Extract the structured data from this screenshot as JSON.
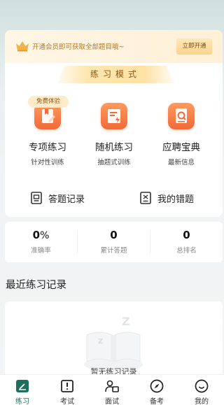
{
  "vip": {
    "text": "开通会员即可获取全部题目哦~",
    "button": "立即开通"
  },
  "mode_banner": "练习模式",
  "free_tag": "免费体验",
  "features": [
    {
      "title": "专项练习",
      "subtitle": "针对性训练",
      "icon": "bookmark-book-icon"
    },
    {
      "title": "随机练习",
      "subtitle": "抽题式训练",
      "icon": "random-doc-icon"
    },
    {
      "title": "应聘宝典",
      "subtitle": "最新信息",
      "icon": "search-book-icon"
    }
  ],
  "links": {
    "answer_record": "答题记录",
    "my_mistakes": "我的错题"
  },
  "stats": {
    "accuracy_value": "0",
    "accuracy_unit": "%",
    "accuracy_label": "准确率",
    "total_value": "0",
    "total_label": "累计答题",
    "rank_value": "0",
    "rank_label": "总排名"
  },
  "recent": {
    "title": "最近练习记录",
    "empty_text": "暂无练习记录"
  },
  "tabs": [
    {
      "label": "练习",
      "icon": "practice-icon",
      "active": true
    },
    {
      "label": "考试",
      "icon": "exam-icon",
      "active": false
    },
    {
      "label": "面试",
      "icon": "interview-icon",
      "active": false
    },
    {
      "label": "备考",
      "icon": "compass-icon",
      "active": false
    },
    {
      "label": "我的",
      "icon": "smile-icon",
      "active": false
    }
  ],
  "colors": {
    "accent_green": "#1f6f5e",
    "orange": "#f06a3a",
    "gold": "#b17a2e"
  }
}
